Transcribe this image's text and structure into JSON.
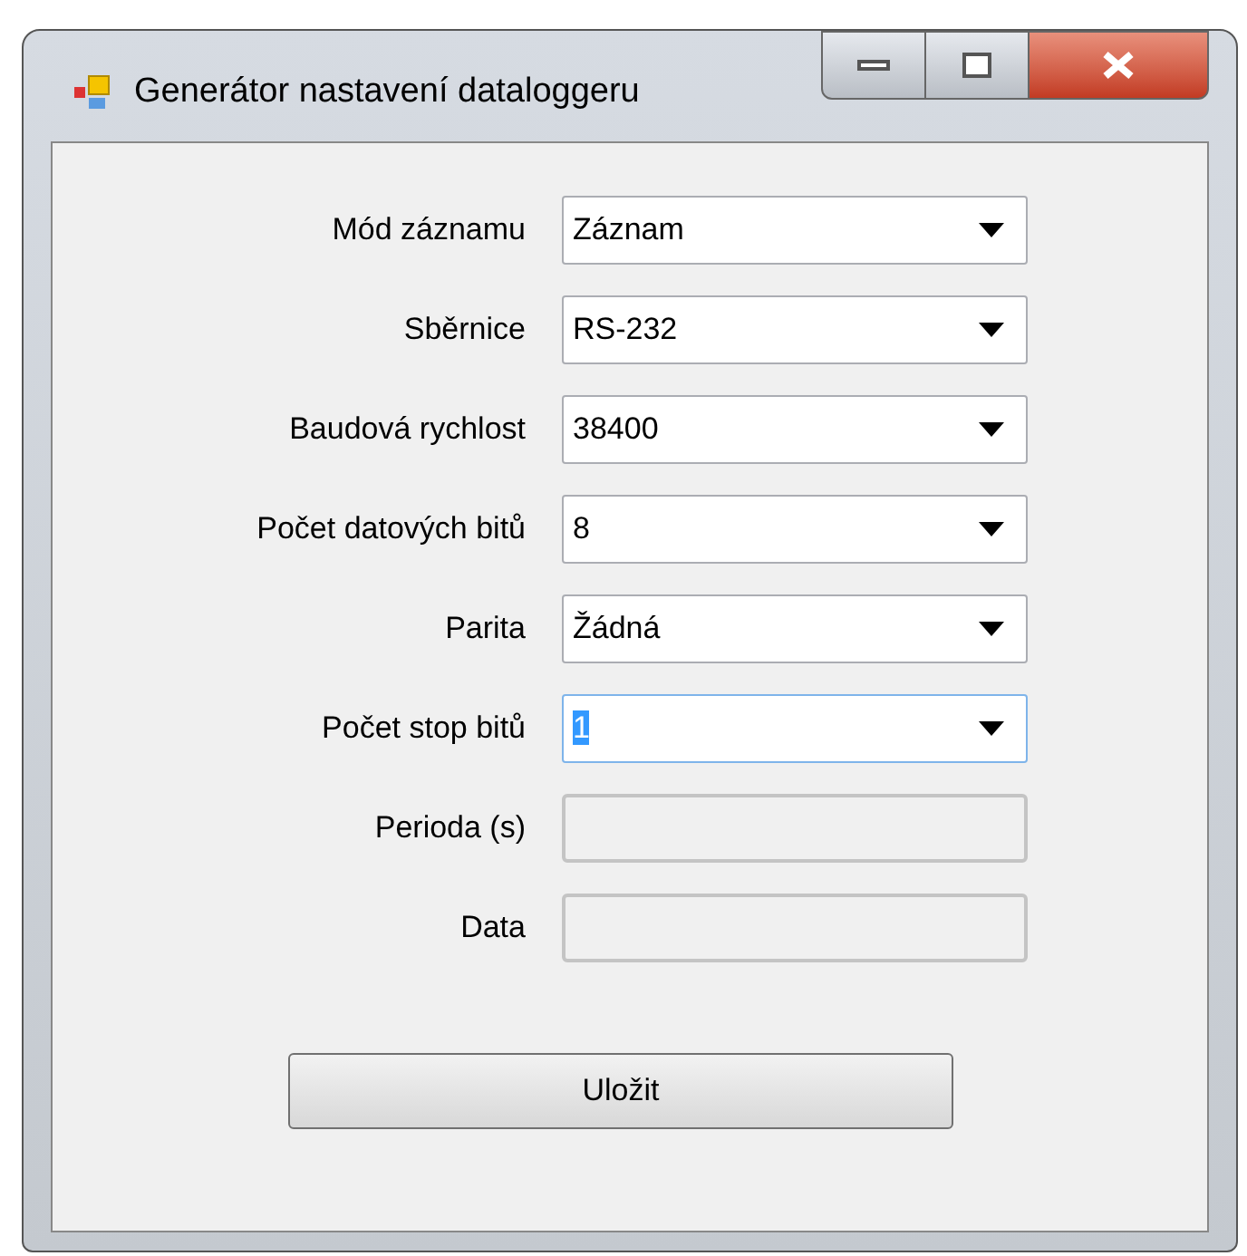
{
  "window": {
    "title": "Generátor nastavení dataloggeru"
  },
  "fields": [
    {
      "label": "Mód záznamu",
      "kind": "dropdown",
      "value": "Záznam",
      "focused": false,
      "disabled": false
    },
    {
      "label": "Sběrnice",
      "kind": "dropdown",
      "value": "RS-232",
      "focused": false,
      "disabled": false
    },
    {
      "label": "Baudová rychlost",
      "kind": "dropdown",
      "value": "38400",
      "focused": false,
      "disabled": false
    },
    {
      "label": "Počet datových bitů",
      "kind": "dropdown",
      "value": "8",
      "focused": false,
      "disabled": false
    },
    {
      "label": "Parita",
      "kind": "dropdown",
      "value": "Žádná",
      "focused": false,
      "disabled": false
    },
    {
      "label": "Počet stop bitů",
      "kind": "dropdown",
      "value": "1",
      "focused": true,
      "disabled": false
    },
    {
      "label": "Perioda (s)",
      "kind": "text",
      "focused": false,
      "disabled": true
    },
    {
      "label": "Data",
      "kind": "text",
      "focused": false,
      "disabled": true
    }
  ],
  "save_button": {
    "label": "Uložit"
  }
}
